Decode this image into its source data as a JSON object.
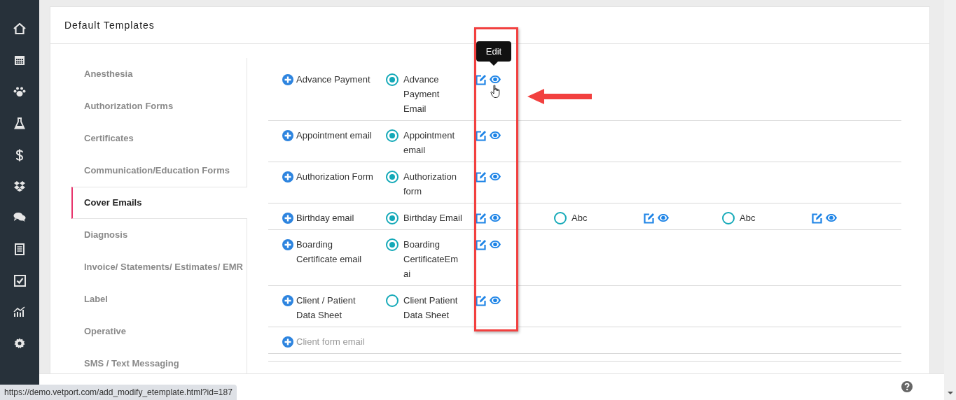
{
  "card": {
    "title": "Default Templates"
  },
  "categories": [
    {
      "label": "Anesthesia",
      "selected": false
    },
    {
      "label": "Authorization Forms",
      "selected": false
    },
    {
      "label": "Certificates",
      "selected": false
    },
    {
      "label": "Communication/Education Forms",
      "selected": false
    },
    {
      "label": "Cover Emails",
      "selected": true
    },
    {
      "label": "Diagnosis",
      "selected": false
    },
    {
      "label": "Invoice/ Statements/ Estimates/ EMR",
      "selected": false
    },
    {
      "label": "Label",
      "selected": false
    },
    {
      "label": "Operative",
      "selected": false
    },
    {
      "label": "SMS / Text Messaging",
      "selected": false
    }
  ],
  "templates": [
    {
      "name": "Advance Payment",
      "disabled": false,
      "options": [
        {
          "label": "Advance Payment Email",
          "selected": true
        }
      ]
    },
    {
      "name": "Appointment email",
      "disabled": false,
      "options": [
        {
          "label": "Appointment email",
          "selected": true
        }
      ]
    },
    {
      "name": "Authorization Form",
      "disabled": false,
      "options": [
        {
          "label": "Authorization form",
          "selected": true
        }
      ]
    },
    {
      "name": "Birthday email",
      "disabled": false,
      "options": [
        {
          "label": "Birthday Email",
          "selected": true
        },
        {
          "label": "Abc",
          "selected": false
        },
        {
          "label": "Abc",
          "selected": false
        }
      ]
    },
    {
      "name": "Boarding Certificate email",
      "disabled": false,
      "options": [
        {
          "label": "Boarding CertificateEmai",
          "selected": true
        }
      ]
    },
    {
      "name": "Client / Patient Data Sheet",
      "disabled": false,
      "options": [
        {
          "label": "Client Patient Data Sheet",
          "selected": false
        }
      ]
    },
    {
      "name": "Client form email",
      "disabled": true
    }
  ],
  "tooltip": {
    "text": "Edit"
  },
  "status_bar": {
    "url": "https://demo.vetport.com/add_modify_etemplate.html?id=187"
  }
}
